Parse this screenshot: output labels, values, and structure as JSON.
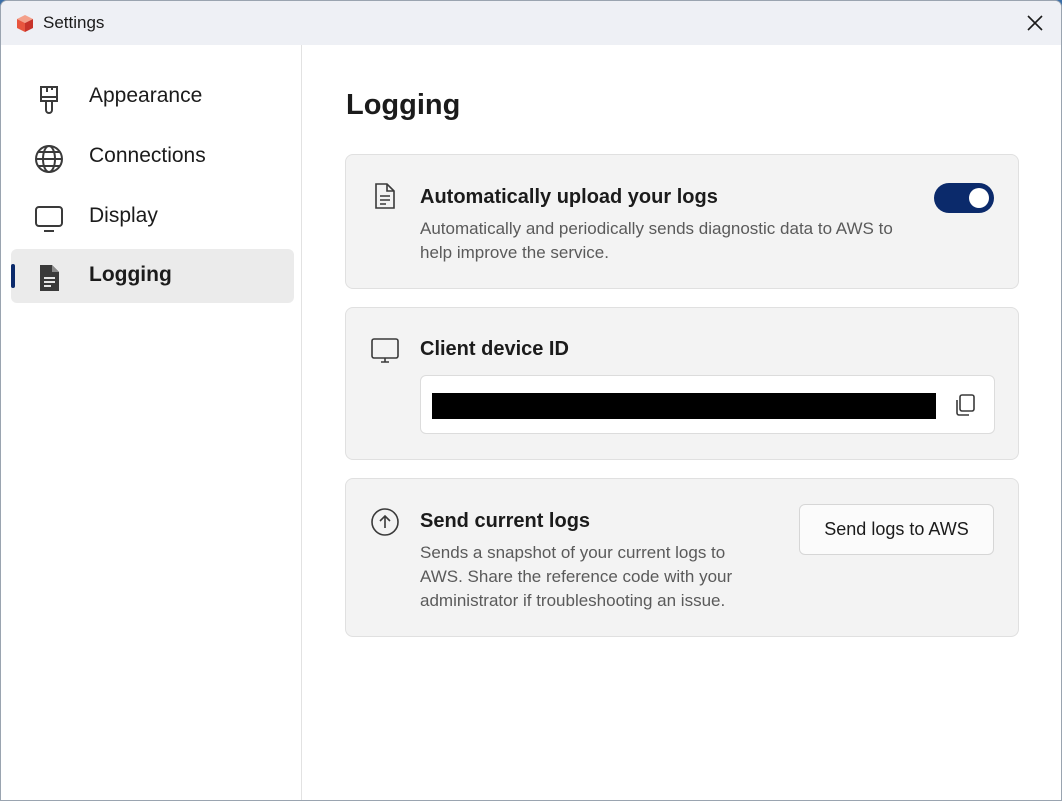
{
  "window": {
    "title": "Settings"
  },
  "sidebar": {
    "items": [
      {
        "label": "Appearance",
        "icon": "paintbrush-icon",
        "active": false
      },
      {
        "label": "Connections",
        "icon": "globe-icon",
        "active": false
      },
      {
        "label": "Display",
        "icon": "monitor-icon",
        "active": false
      },
      {
        "label": "Logging",
        "icon": "document-icon",
        "active": true
      }
    ]
  },
  "main": {
    "title": "Logging",
    "auto_upload": {
      "title": "Automatically upload your logs",
      "description": "Automatically and periodically sends diagnostic data to AWS to help improve the service.",
      "enabled": true
    },
    "device_id": {
      "title": "Client device ID",
      "value_redacted": true
    },
    "send_logs": {
      "title": "Send current logs",
      "description": "Sends a snapshot of your current logs to AWS. Share the reference code with your administrator if troubleshooting an issue.",
      "button_label": "Send logs to AWS"
    }
  },
  "colors": {
    "accent": "#0b2a6b",
    "card_bg": "#f3f3f3",
    "active_nav_bg": "#ebebeb"
  }
}
